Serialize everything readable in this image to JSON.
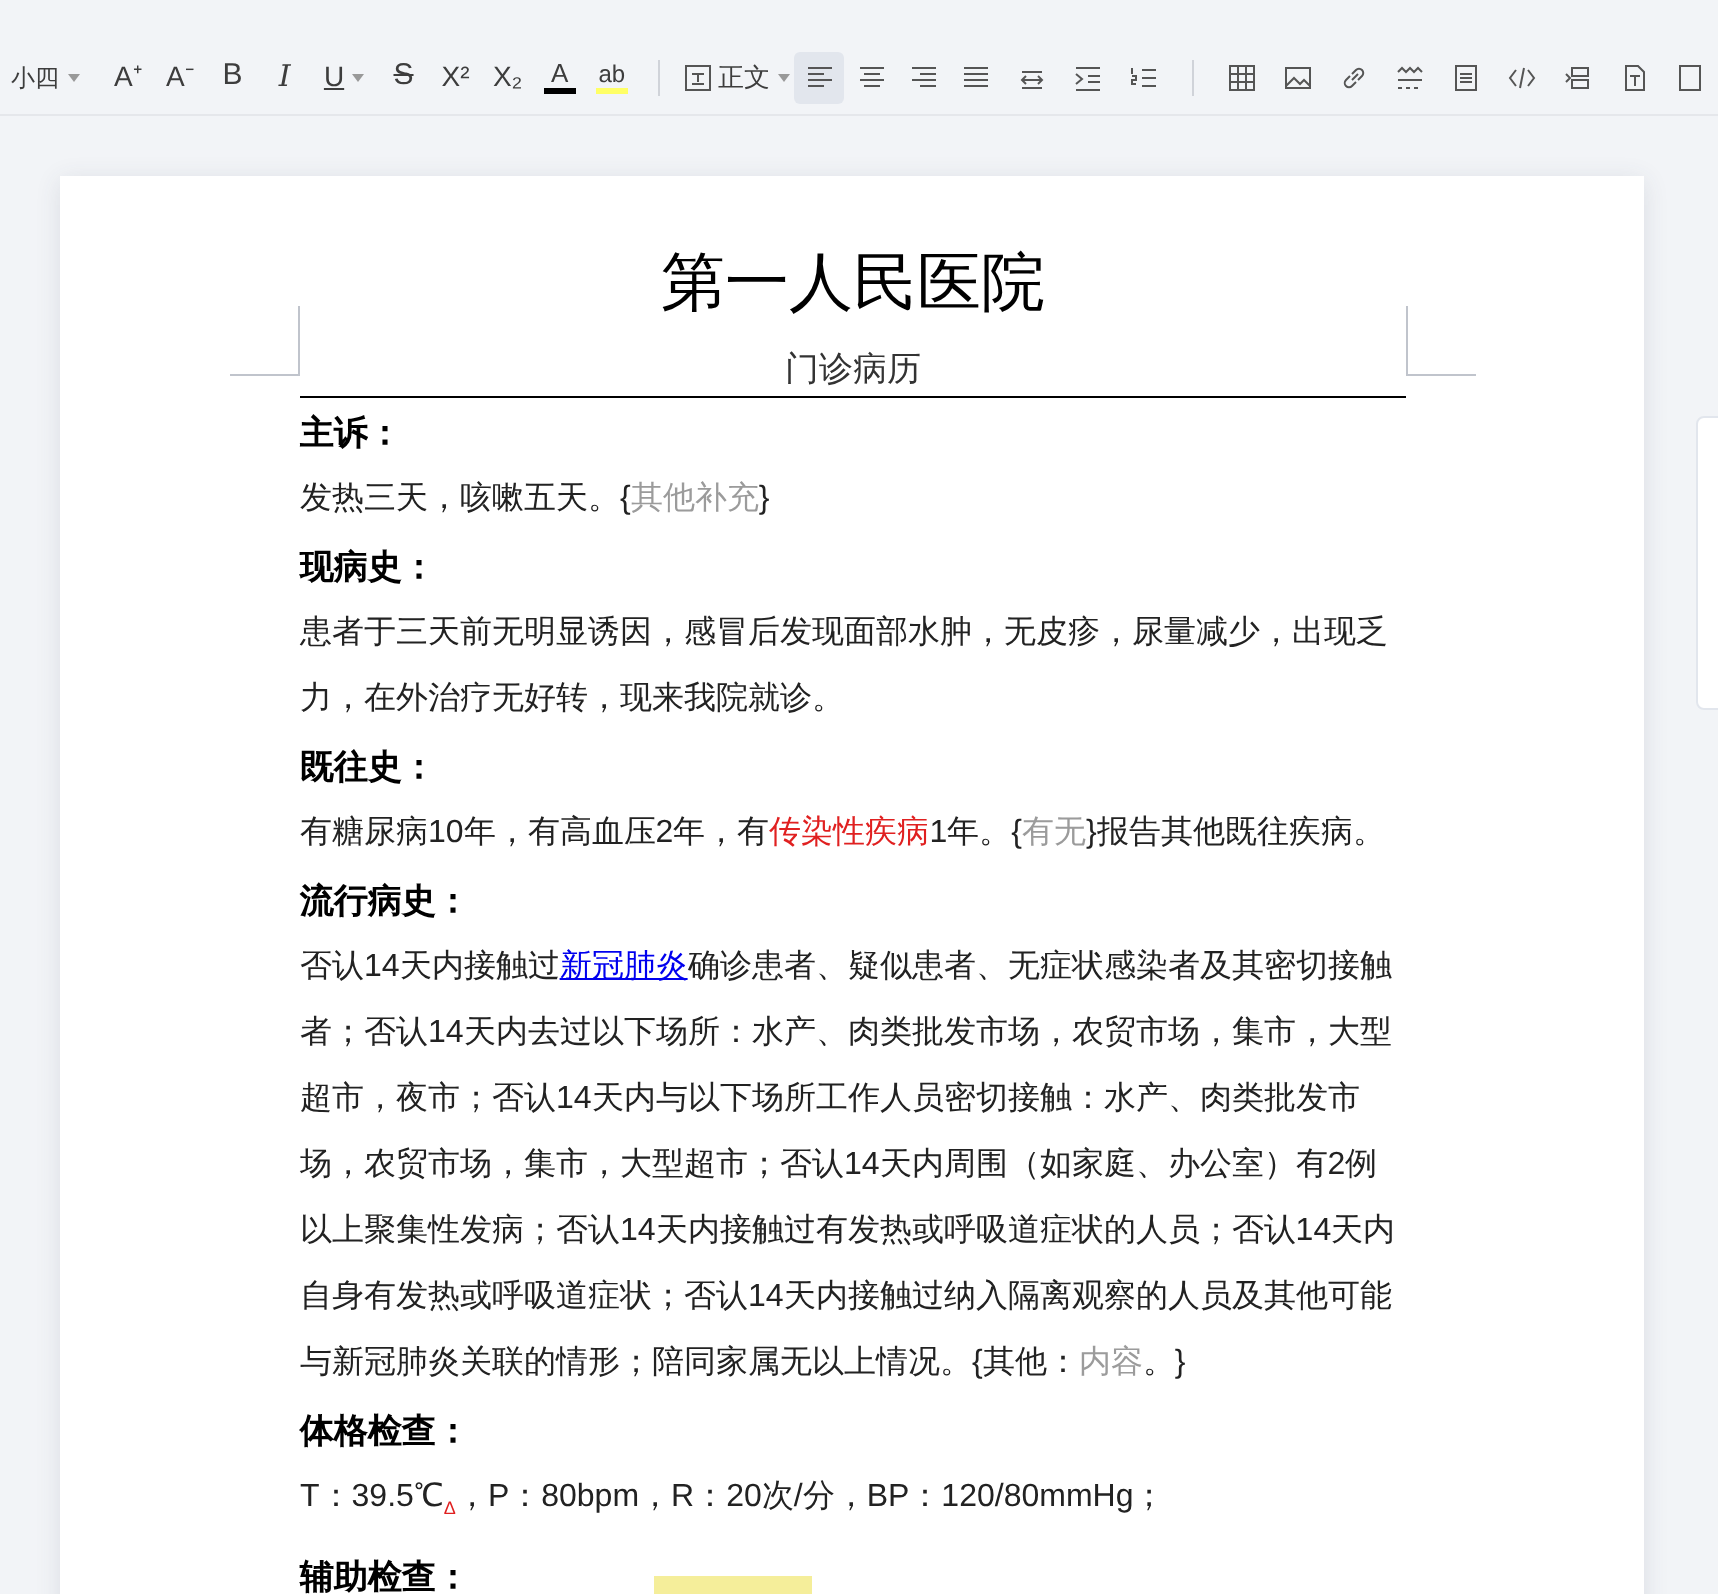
{
  "toolbar": {
    "font_size": "小四",
    "font_grow": "A⁺",
    "font_shrink": "A⁻",
    "bold": "B",
    "italic": "I",
    "underline": "U",
    "strikethrough": "S",
    "superscript": "X²",
    "subscript": "X₂",
    "font_color": "A",
    "highlight": "ab",
    "style": "正文",
    "align": [
      {
        "selected": true
      },
      {
        "selected": false
      },
      {
        "selected": false
      },
      {
        "selected": false
      }
    ]
  },
  "document": {
    "title": "第一人民医院",
    "subtitle": "门诊病历",
    "sections": [
      {
        "heading": "主诉：",
        "paragraphs": [
          [
            {
              "text": "发热三天，咳嗽五天。{",
              "kind": "plain"
            },
            {
              "text": "其他补充",
              "kind": "placeholder"
            },
            {
              "text": "}",
              "kind": "plain"
            }
          ]
        ]
      },
      {
        "heading": "现病史：",
        "paragraphs": [
          [
            {
              "text": "患者于三天前无明显诱因，感冒后发现面部水肿，无皮疹，尿量减少，出现乏力，在外治疗无好转，现来我院就诊。",
              "kind": "plain"
            }
          ]
        ]
      },
      {
        "heading": "既往史：",
        "paragraphs": [
          [
            {
              "text": "有糖尿病10年，有高血压2年，有",
              "kind": "plain"
            },
            {
              "text": "传染性疾病",
              "kind": "red"
            },
            {
              "text": "1年。{",
              "kind": "plain"
            },
            {
              "text": "有无",
              "kind": "placeholder"
            },
            {
              "text": "}报告其他既往疾病。",
              "kind": "plain"
            }
          ]
        ]
      },
      {
        "heading": "流行病史：",
        "paragraphs": [
          [
            {
              "text": "否认14天内接触过",
              "kind": "plain"
            },
            {
              "text": "新冠肺炎",
              "kind": "link"
            },
            {
              "text": "确诊患者、疑似患者、无症状感染者及其密切接触者；否认14天内去过以下场所：水产、肉类批发市场，农贸市场，集市，大型超市，夜市；否认14天内与以下场所工作人员密切接触：水产、肉类批发市场，农贸市场，集市，大型超市；否认14天内周围（如家庭、办公室）有2例以上聚集性发病；否认14天内接触过有发热或呼吸道症状的人员；否认14天内自身有发热或呼吸道症状；否认14天内接触过纳入隔离观察的人员及其他可能与新冠肺炎关联的情形；陪同家属无以上情况。{其他：",
              "kind": "plain"
            },
            {
              "text": "内容",
              "kind": "placeholder"
            },
            {
              "text": "。}",
              "kind": "plain"
            }
          ]
        ]
      },
      {
        "heading": "体格检查：",
        "paragraphs": [
          [
            {
              "text": "T：39.5℃",
              "kind": "plain"
            },
            {
              "text": "Δ",
              "kind": "mark"
            },
            {
              "text": "，P：80bpm，R：20次/分，BP：120/80mmHg；",
              "kind": "plain"
            }
          ]
        ]
      },
      {
        "heading": "辅助检查："
      }
    ]
  }
}
